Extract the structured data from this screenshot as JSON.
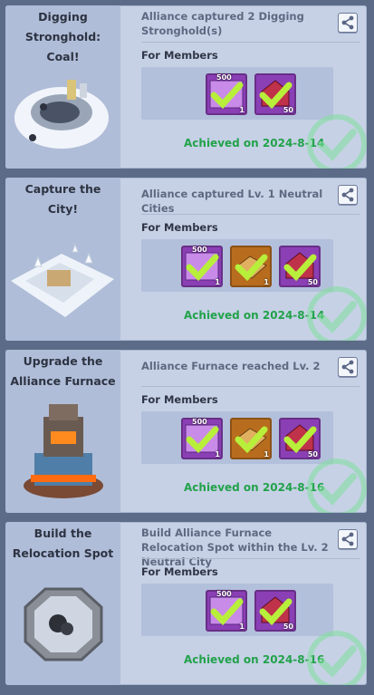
{
  "achievements": [
    {
      "title": "Digging Stronghold: Coal!",
      "description": "Alliance captured 2 Digging Stronghold(s)",
      "members_label": "For Members",
      "rewards": [
        {
          "type": "purple",
          "top_count": "500",
          "count": "1"
        },
        {
          "type": "purple-red",
          "top_count": "",
          "count": "50"
        }
      ],
      "achieved": "Achieved on 2024-8-14",
      "art": "coal-stronghold-art"
    },
    {
      "title": "Capture the City!",
      "description": "Alliance captured Lv. 1 Neutral Cities",
      "members_label": "For Members",
      "rewards": [
        {
          "type": "purple",
          "top_count": "500",
          "count": "1"
        },
        {
          "type": "orange",
          "top_count": "",
          "count": "1"
        },
        {
          "type": "purple-red",
          "top_count": "",
          "count": "50"
        }
      ],
      "achieved": "Achieved on 2024-8-14",
      "art": "snow-city-art"
    },
    {
      "title": "Upgrade the Alliance Furnace",
      "description": "Alliance Furnace reached Lv. 2",
      "members_label": "For Members",
      "rewards": [
        {
          "type": "purple",
          "top_count": "500",
          "count": "1"
        },
        {
          "type": "orange",
          "top_count": "",
          "count": "1"
        },
        {
          "type": "purple-red",
          "top_count": "",
          "count": "50"
        }
      ],
      "achieved": "Achieved on 2024-8-16",
      "art": "furnace-art"
    },
    {
      "title": "Build the Relocation Spot",
      "description": "Build Alliance Furnace Relocation Spot within the Lv. 2 Neutral City",
      "members_label": "For Members",
      "rewards": [
        {
          "type": "purple",
          "top_count": "500",
          "count": "1"
        },
        {
          "type": "purple-red",
          "top_count": "",
          "count": "50"
        }
      ],
      "achieved": "Achieved on 2024-8-16",
      "art": "relocation-spot-art"
    }
  ],
  "icons": {
    "share": "share-icon",
    "completed": "check-circle-icon"
  },
  "colors": {
    "achieved_green": "#22a24a",
    "card_bg": "#c6d1e6",
    "check_faint": "#7fe09a"
  }
}
